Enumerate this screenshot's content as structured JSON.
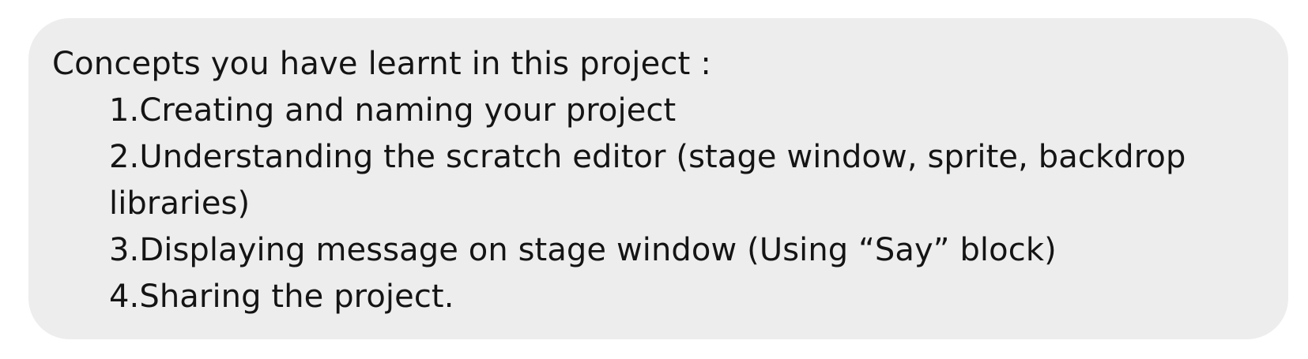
{
  "card": {
    "heading": "Concepts you have learnt in this project :",
    "items": [
      "1.Creating and naming your project",
      "2.Understanding the scratch editor (stage window, sprite, backdrop libraries)",
      "3.Displaying message on stage window (Using “Say” block)",
      "4.Sharing the project."
    ]
  },
  "colors": {
    "card_background": "#ededed",
    "text": "#141414",
    "page_background": "#ffffff"
  }
}
